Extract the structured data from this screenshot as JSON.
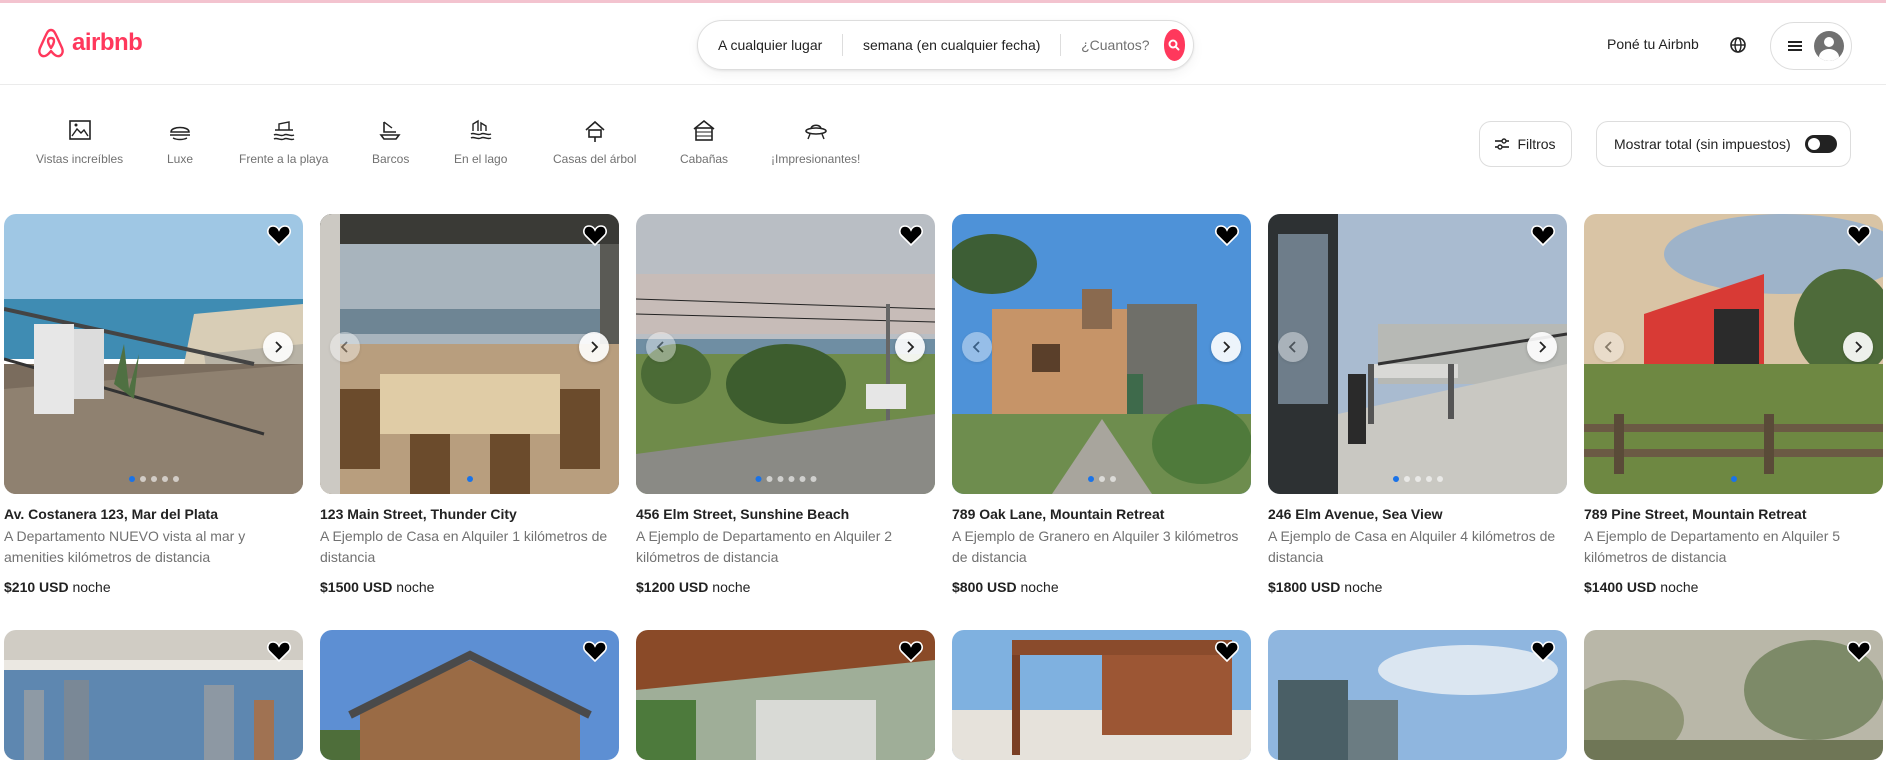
{
  "brand": {
    "name": "airbnb",
    "color": "#ff385c"
  },
  "search": {
    "where": "A cualquier lugar",
    "when": "semana (en cualquier fecha)",
    "guests": "¿Cuantos?",
    "button_icon": "search-icon"
  },
  "header": {
    "host_label": "Poné tu Airbnb",
    "globe_icon": "globe-icon",
    "menu_icon": "hamburger-icon"
  },
  "categories": [
    {
      "label": "Vistas increíbles",
      "icon": "view-icon"
    },
    {
      "label": "Luxe",
      "icon": "luxe-icon"
    },
    {
      "label": "Frente a la playa",
      "icon": "beach-icon"
    },
    {
      "label": "Barcos",
      "icon": "boat-icon"
    },
    {
      "label": "En el lago",
      "icon": "lake-icon"
    },
    {
      "label": "Casas del árbol",
      "icon": "treehouse-icon"
    },
    {
      "label": "Cabañas",
      "icon": "cabin-icon"
    },
    {
      "label": "¡Impresionantes!",
      "icon": "ufo-icon"
    }
  ],
  "filters": {
    "label": "Filtros",
    "icon": "sliders-icon"
  },
  "tax_toggle": {
    "label": "Mostrar total (sin impuestos)",
    "on": false
  },
  "listings": [
    {
      "title": "Av. Costanera 123, Mar del Plata",
      "desc": "A Departamento NUEVO vista al mar y amenities kilómetros de distancia",
      "price": "$210 USD",
      "unit": "noche"
    },
    {
      "title": "123 Main Street, Thunder City",
      "desc": "A Ejemplo de Casa en Alquiler 1 kilómetros de distancia",
      "price": "$1500 USD",
      "unit": "noche"
    },
    {
      "title": "456 Elm Street, Sunshine Beach",
      "desc": "A Ejemplo de Departamento en Alquiler 2 kilómetros de distancia",
      "price": "$1200 USD",
      "unit": "noche"
    },
    {
      "title": "789 Oak Lane, Mountain Retreat",
      "desc": "A Ejemplo de Granero en Alquiler 3 kilómetros de distancia",
      "price": "$800 USD",
      "unit": "noche"
    },
    {
      "title": "246 Elm Avenue, Sea View",
      "desc": "A Ejemplo de Casa en Alquiler 4 kilómetros de distancia",
      "price": "$1800 USD",
      "unit": "noche"
    },
    {
      "title": "789 Pine Street, Mountain Retreat",
      "desc": "A Ejemplo de Departamento en Alquiler 5 kilómetros de distancia",
      "price": "$1400 USD",
      "unit": "noche"
    }
  ]
}
